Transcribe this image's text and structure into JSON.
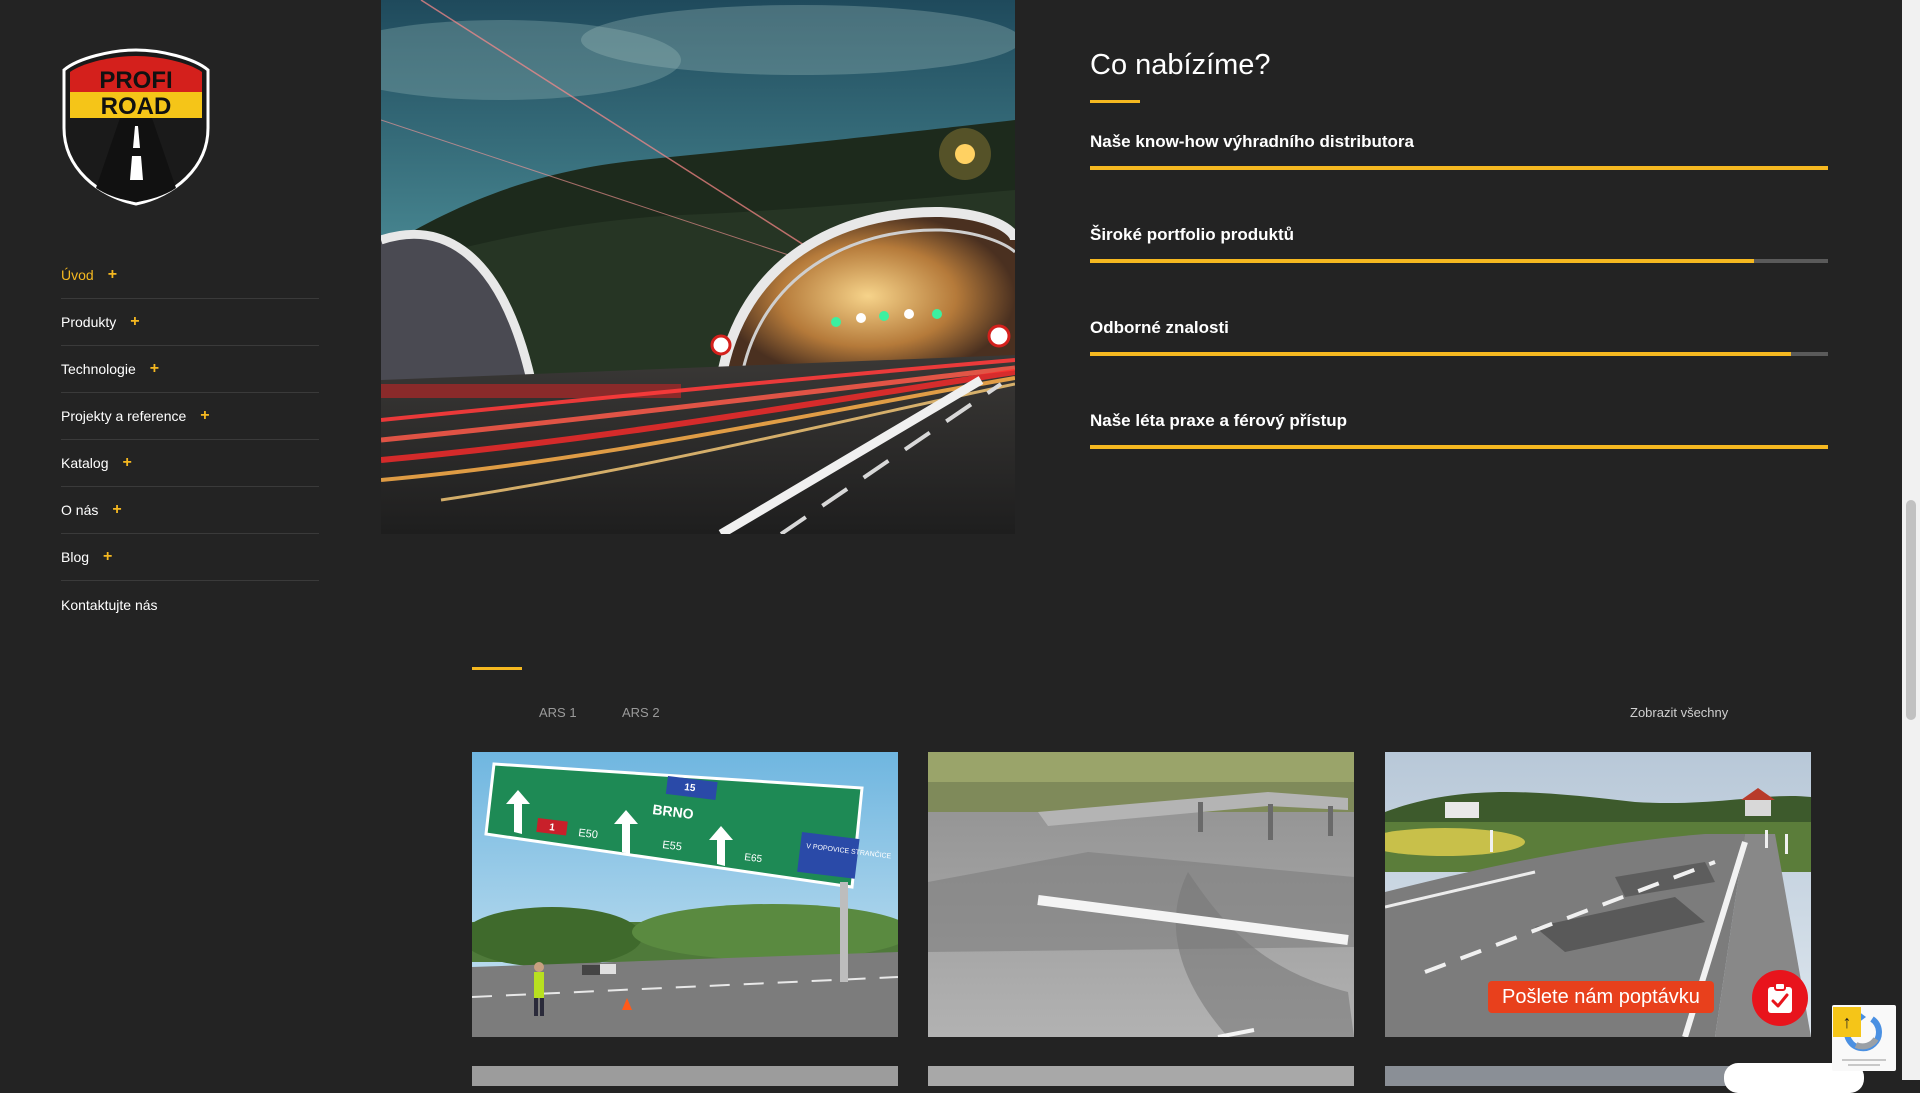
{
  "brand": {
    "logo_top": "PROFI",
    "logo_bottom": "ROAD"
  },
  "nav": {
    "items": [
      {
        "label": "Úvod",
        "has_submenu": true,
        "active": true
      },
      {
        "label": "Produkty",
        "has_submenu": true
      },
      {
        "label": "Technologie",
        "has_submenu": true
      },
      {
        "label": "Projekty a reference",
        "has_submenu": true
      },
      {
        "label": "Katalog",
        "has_submenu": true
      },
      {
        "label": "O nás",
        "has_submenu": true
      },
      {
        "label": "Blog",
        "has_submenu": true
      },
      {
        "label": "Kontaktujte nás",
        "has_submenu": false
      }
    ],
    "plus_symbol": "+"
  },
  "offer": {
    "title": "Co nabízíme?",
    "skills": [
      {
        "label": "Naše know-how výhradního distributora",
        "percent": 100
      },
      {
        "label": "Široké portfolio produktů",
        "percent": 90
      },
      {
        "label": "Odborné znalosti",
        "percent": 95
      },
      {
        "label": "Naše léta praxe a férový přístup",
        "percent": 100
      }
    ]
  },
  "portfolio": {
    "filters": [
      "ARS 1",
      "ARS 2"
    ],
    "show_all": "Zobrazit všechny",
    "thumbnails": [
      {
        "name": "highway-sign-brno",
        "sign_text": "BRNO",
        "route_red": "1",
        "route_e1": "E50",
        "route_e2": "E55",
        "route_e3": "E65",
        "exit_text": "V POPOVICE STRANČICE",
        "km_text": "15"
      },
      {
        "name": "road-repair-guardrail"
      },
      {
        "name": "rural-road-patches"
      }
    ]
  },
  "widgets": {
    "inquiry_label": "Pošlete nám poptávku",
    "inquiry_icon": "clipboard-check-icon",
    "scroll_top_icon": "arrow-up-icon",
    "scroll_top_symbol": "↑"
  },
  "colors": {
    "accent": "#f5b820",
    "background": "#232323",
    "inquiry_red": "#e8401c"
  }
}
